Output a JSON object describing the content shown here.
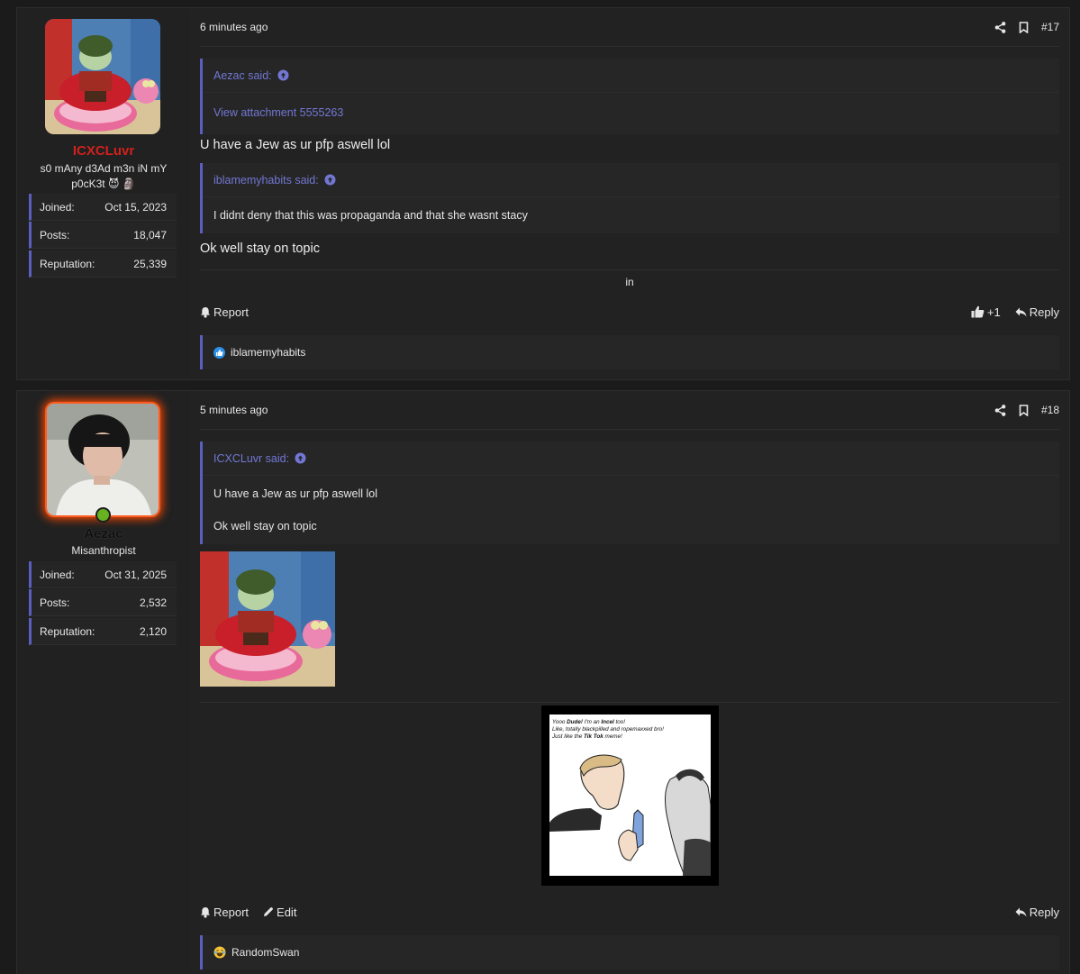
{
  "posts": [
    {
      "id": "post17",
      "user": {
        "name": "ICXCLuvr",
        "title": "s0 mAny d3Ad m3n iN mY p0cK3t 😈 🗿",
        "stats": [
          {
            "label": "Joined:",
            "value": "Oct 15, 2023"
          },
          {
            "label": "Posts:",
            "value": "18,047"
          },
          {
            "label": "Reputation:",
            "value": "25,339"
          }
        ]
      },
      "time": "6 minutes ago",
      "number": "#17",
      "quote1": {
        "author": "Aezac said:",
        "link": "View attachment 5555263"
      },
      "message1": "U have a Jew as ur pfp aswell lol",
      "quote2": {
        "author": "iblamemyhabits said:",
        "body": "I didnt deny that this was propaganda and that she wasnt stacy"
      },
      "message2": "Ok well stay on topic",
      "center_text": "in",
      "actions": {
        "report": "Report",
        "like_count": "+1",
        "reply": "Reply"
      },
      "reactions": {
        "user": "iblamemyhabits",
        "icon": "like-icon"
      }
    },
    {
      "id": "post18",
      "user": {
        "name": "Aezac",
        "title": "Misanthropist",
        "stats": [
          {
            "label": "Joined:",
            "value": "Oct 31, 2025"
          },
          {
            "label": "Posts:",
            "value": "2,532"
          },
          {
            "label": "Reputation:",
            "value": "2,120"
          }
        ]
      },
      "time": "5 minutes ago",
      "number": "#18",
      "quote1": {
        "author": "ICXCLuvr said:",
        "line1": "U have a Jew as ur pfp aswell lol",
        "line2": "Ok well stay on topic"
      },
      "meme": {
        "line1_a": "Yooo ",
        "line1_b": "Dude!",
        "line1_c": " I'm an ",
        "line1_d": "Incel",
        "line1_e": " too!",
        "line2": "Like, totally blackpilled and ropemaxxed bro!",
        "line3_a": "Just like the ",
        "line3_b": "Tik Tok",
        "line3_c": " meme!"
      },
      "actions": {
        "report": "Report",
        "edit": "Edit",
        "reply": "Reply"
      },
      "reactions": {
        "user": "RandomSwan",
        "icon": "laugh-emoji-icon"
      }
    }
  ],
  "colors": {
    "accent": "#5a5fbf",
    "link": "#7277d3",
    "username_red": "#d0211d",
    "online": "#66b21f",
    "glow": "#ff4a00"
  }
}
